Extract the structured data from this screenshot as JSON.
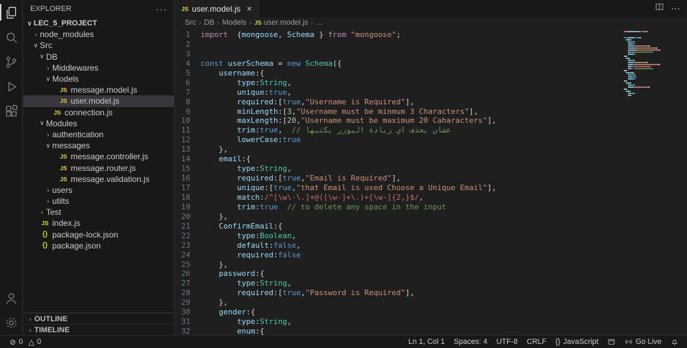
{
  "colors": {
    "tokens": {
      "k": "#c586c0",
      "c": "#569cd6",
      "v": "#9cdcfe",
      "t": "#4ec9b0",
      "s": "#ce9178",
      "n": "#b5cea8",
      "m": "#6a9955",
      "p": "#d4d4d4",
      "r": "#d16969"
    },
    "js_icon": "#e8d44d",
    "json_icon": "#cbcb41",
    "selection_bg": "#37373d"
  },
  "icons": {
    "js_badge": "JS",
    "json_badge": "{}"
  },
  "activity_bar": {
    "icons": [
      {
        "name": "explorer",
        "active": true
      },
      {
        "name": "search",
        "active": false
      },
      {
        "name": "source-control",
        "active": false
      },
      {
        "name": "run-debug",
        "active": false
      },
      {
        "name": "extensions",
        "active": false
      }
    ],
    "bottom_icons": [
      {
        "name": "account"
      },
      {
        "name": "settings"
      }
    ]
  },
  "sidebar": {
    "title": "EXPLORER",
    "more": "···",
    "tree": [
      {
        "label": "LEC_5_PROJECT",
        "level": 0,
        "arrow": "expanded",
        "bold": true
      },
      {
        "label": "node_modules",
        "level": 1,
        "arrow": "collapsed"
      },
      {
        "label": "Src",
        "level": 1,
        "arrow": "expanded"
      },
      {
        "label": "DB",
        "level": 2,
        "arrow": "expanded"
      },
      {
        "label": "Middlewares",
        "level": 3,
        "arrow": "collapsed"
      },
      {
        "label": "Models",
        "level": 3,
        "arrow": "expanded"
      },
      {
        "label": "message.model.js",
        "level": 4,
        "icon": "js"
      },
      {
        "label": "user.model.js",
        "level": 4,
        "icon": "js",
        "selected": true
      },
      {
        "label": "connection.js",
        "level": 3,
        "icon": "js"
      },
      {
        "label": "Modules",
        "level": 2,
        "arrow": "expanded"
      },
      {
        "label": "authentication",
        "level": 3,
        "arrow": "collapsed"
      },
      {
        "label": "messages",
        "level": 3,
        "arrow": "expanded"
      },
      {
        "label": "message.controller.js",
        "level": 4,
        "icon": "js"
      },
      {
        "label": "message.router.js",
        "level": 4,
        "icon": "js"
      },
      {
        "label": "message.validation.js",
        "level": 4,
        "icon": "js"
      },
      {
        "label": "users",
        "level": 3,
        "arrow": "collapsed"
      },
      {
        "label": "utilts",
        "level": 3,
        "arrow": "collapsed"
      },
      {
        "label": "Test",
        "level": 2,
        "arrow": "collapsed"
      },
      {
        "label": "index.js",
        "level": 1,
        "icon": "js"
      },
      {
        "label": "package-lock.json",
        "level": 1,
        "icon": "json"
      },
      {
        "label": "package.json",
        "level": 1,
        "icon": "json"
      }
    ],
    "sections": [
      {
        "label": "OUTLINE"
      },
      {
        "label": "TIMELINE"
      }
    ]
  },
  "editor": {
    "tab": {
      "label": "user.model.js",
      "close": "×"
    },
    "breadcrumb": [
      {
        "label": "Src"
      },
      {
        "label": "DB"
      },
      {
        "label": "Models"
      },
      {
        "label": "user.model.js",
        "icon": "js"
      },
      {
        "label": "..."
      }
    ],
    "code": {
      "lines": [
        [
          [
            "k",
            "import"
          ],
          [
            "p",
            "  {"
          ],
          [
            "v",
            "mongoose"
          ],
          [
            "p",
            ", "
          ],
          [
            "v",
            "Schema"
          ],
          [
            "p",
            " } "
          ],
          [
            "k",
            "from"
          ],
          [
            "p",
            " "
          ],
          [
            "s",
            "\"mongoose\""
          ],
          [
            "p",
            ";"
          ]
        ],
        [],
        [],
        [
          [
            "c",
            "const"
          ],
          [
            "p",
            " "
          ],
          [
            "v",
            "userSchema"
          ],
          [
            "p",
            " = "
          ],
          [
            "c",
            "new"
          ],
          [
            "p",
            " "
          ],
          [
            "t",
            "Schema"
          ],
          [
            "p",
            "({"
          ]
        ],
        [
          [
            "p",
            "    "
          ],
          [
            "v",
            "username"
          ],
          [
            "p",
            ":{"
          ]
        ],
        [
          [
            "p",
            "        "
          ],
          [
            "v",
            "type"
          ],
          [
            "p",
            ":"
          ],
          [
            "t",
            "String"
          ],
          [
            "p",
            ","
          ]
        ],
        [
          [
            "p",
            "        "
          ],
          [
            "v",
            "unique"
          ],
          [
            "p",
            ":"
          ],
          [
            "c",
            "true"
          ],
          [
            "p",
            ","
          ]
        ],
        [
          [
            "p",
            "        "
          ],
          [
            "v",
            "required"
          ],
          [
            "p",
            ":["
          ],
          [
            "c",
            "true"
          ],
          [
            "p",
            ","
          ],
          [
            "s",
            "\"Username is Required\""
          ],
          [
            "p",
            "],"
          ]
        ],
        [
          [
            "p",
            "        "
          ],
          [
            "v",
            "minLength"
          ],
          [
            "p",
            ":["
          ],
          [
            "n",
            "3"
          ],
          [
            "p",
            ","
          ],
          [
            "s",
            "\"Username must be minmum 3 Characters\""
          ],
          [
            "p",
            "],"
          ]
        ],
        [
          [
            "p",
            "        "
          ],
          [
            "v",
            "maxLength"
          ],
          [
            "p",
            ":["
          ],
          [
            "n",
            "20"
          ],
          [
            "p",
            ","
          ],
          [
            "s",
            "\"Username must be maximum 20 Caharacters\""
          ],
          [
            "p",
            "],"
          ]
        ],
        [
          [
            "p",
            "        "
          ],
          [
            "v",
            "trim"
          ],
          [
            "p",
            ":"
          ],
          [
            "c",
            "true"
          ],
          [
            "p",
            ",  "
          ],
          [
            "m",
            "// عشان يحذف اي زيادة اليوزر يكتبها"
          ]
        ],
        [
          [
            "p",
            "        "
          ],
          [
            "v",
            "lowerCase"
          ],
          [
            "p",
            ":"
          ],
          [
            "c",
            "true"
          ]
        ],
        [
          [
            "p",
            "    },"
          ]
        ],
        [
          [
            "p",
            "    "
          ],
          [
            "v",
            "email"
          ],
          [
            "p",
            ":{"
          ]
        ],
        [
          [
            "p",
            "        "
          ],
          [
            "v",
            "type"
          ],
          [
            "p",
            ":"
          ],
          [
            "t",
            "String"
          ],
          [
            "p",
            ","
          ]
        ],
        [
          [
            "p",
            "        "
          ],
          [
            "v",
            "required"
          ],
          [
            "p",
            ":["
          ],
          [
            "c",
            "true"
          ],
          [
            "p",
            ","
          ],
          [
            "s",
            "\"Email is Required\""
          ],
          [
            "p",
            "],"
          ]
        ],
        [
          [
            "p",
            "        "
          ],
          [
            "v",
            "unique"
          ],
          [
            "p",
            ":["
          ],
          [
            "c",
            "true"
          ],
          [
            "p",
            ","
          ],
          [
            "s",
            "\"that Email is used Choose a Unique Email\""
          ],
          [
            "p",
            "],"
          ]
        ],
        [
          [
            "p",
            "        "
          ],
          [
            "v",
            "match"
          ],
          [
            "p",
            ":"
          ],
          [
            "r",
            "/^[\\w\\-\\.]+@([\\w-]+\\.)+[\\w-]{2,}$/"
          ],
          [
            "p",
            ","
          ]
        ],
        [
          [
            "p",
            "        "
          ],
          [
            "v",
            "trim"
          ],
          [
            "p",
            ":"
          ],
          [
            "c",
            "true"
          ],
          [
            "p",
            "  "
          ],
          [
            "m",
            "// to delete any space in the input"
          ]
        ],
        [
          [
            "p",
            "    },"
          ]
        ],
        [
          [
            "p",
            "    "
          ],
          [
            "v",
            "ConfirmEmail"
          ],
          [
            "p",
            ":{"
          ]
        ],
        [
          [
            "p",
            "        "
          ],
          [
            "v",
            "type"
          ],
          [
            "p",
            ":"
          ],
          [
            "t",
            "Boolean"
          ],
          [
            "p",
            ","
          ]
        ],
        [
          [
            "p",
            "        "
          ],
          [
            "v",
            "default"
          ],
          [
            "p",
            ":"
          ],
          [
            "c",
            "false"
          ],
          [
            "p",
            ","
          ]
        ],
        [
          [
            "p",
            "        "
          ],
          [
            "v",
            "required"
          ],
          [
            "p",
            ":"
          ],
          [
            "c",
            "false"
          ]
        ],
        [
          [
            "p",
            "    },"
          ]
        ],
        [
          [
            "p",
            "    "
          ],
          [
            "v",
            "password"
          ],
          [
            "p",
            ":{"
          ]
        ],
        [
          [
            "p",
            "        "
          ],
          [
            "v",
            "type"
          ],
          [
            "p",
            ":"
          ],
          [
            "t",
            "String"
          ],
          [
            "p",
            ","
          ]
        ],
        [
          [
            "p",
            "        "
          ],
          [
            "v",
            "required"
          ],
          [
            "p",
            ":["
          ],
          [
            "c",
            "true"
          ],
          [
            "p",
            ","
          ],
          [
            "s",
            "\"Password is Required\""
          ],
          [
            "p",
            "],"
          ]
        ],
        [
          [
            "p",
            "    },"
          ]
        ],
        [
          [
            "p",
            "    "
          ],
          [
            "v",
            "gender"
          ],
          [
            "p",
            ":{"
          ]
        ],
        [
          [
            "p",
            "        "
          ],
          [
            "v",
            "type"
          ],
          [
            "p",
            ":"
          ],
          [
            "t",
            "String"
          ],
          [
            "p",
            ","
          ]
        ],
        [
          [
            "p",
            "        "
          ],
          [
            "v",
            "enum"
          ],
          [
            "p",
            ":{"
          ]
        ]
      ]
    }
  },
  "status_bar": {
    "left": [
      {
        "name": "errors",
        "icon": "error",
        "label": "0"
      },
      {
        "name": "warnings",
        "icon": "warning",
        "label": "0"
      }
    ],
    "right": [
      {
        "name": "cursor-position",
        "label": "Ln 1, Col 1"
      },
      {
        "name": "indentation",
        "label": "Spaces: 4"
      },
      {
        "name": "encoding",
        "label": "UTF-8"
      },
      {
        "name": "eol",
        "label": "CRLF"
      },
      {
        "name": "language-mode",
        "icon": "braces",
        "label": "JavaScript"
      },
      {
        "name": "browser-preview",
        "icon": "browser",
        "label": ""
      },
      {
        "name": "go-live",
        "icon": "broadcast",
        "label": "Go Live"
      },
      {
        "name": "notifications",
        "icon": "bell",
        "label": ""
      }
    ]
  }
}
